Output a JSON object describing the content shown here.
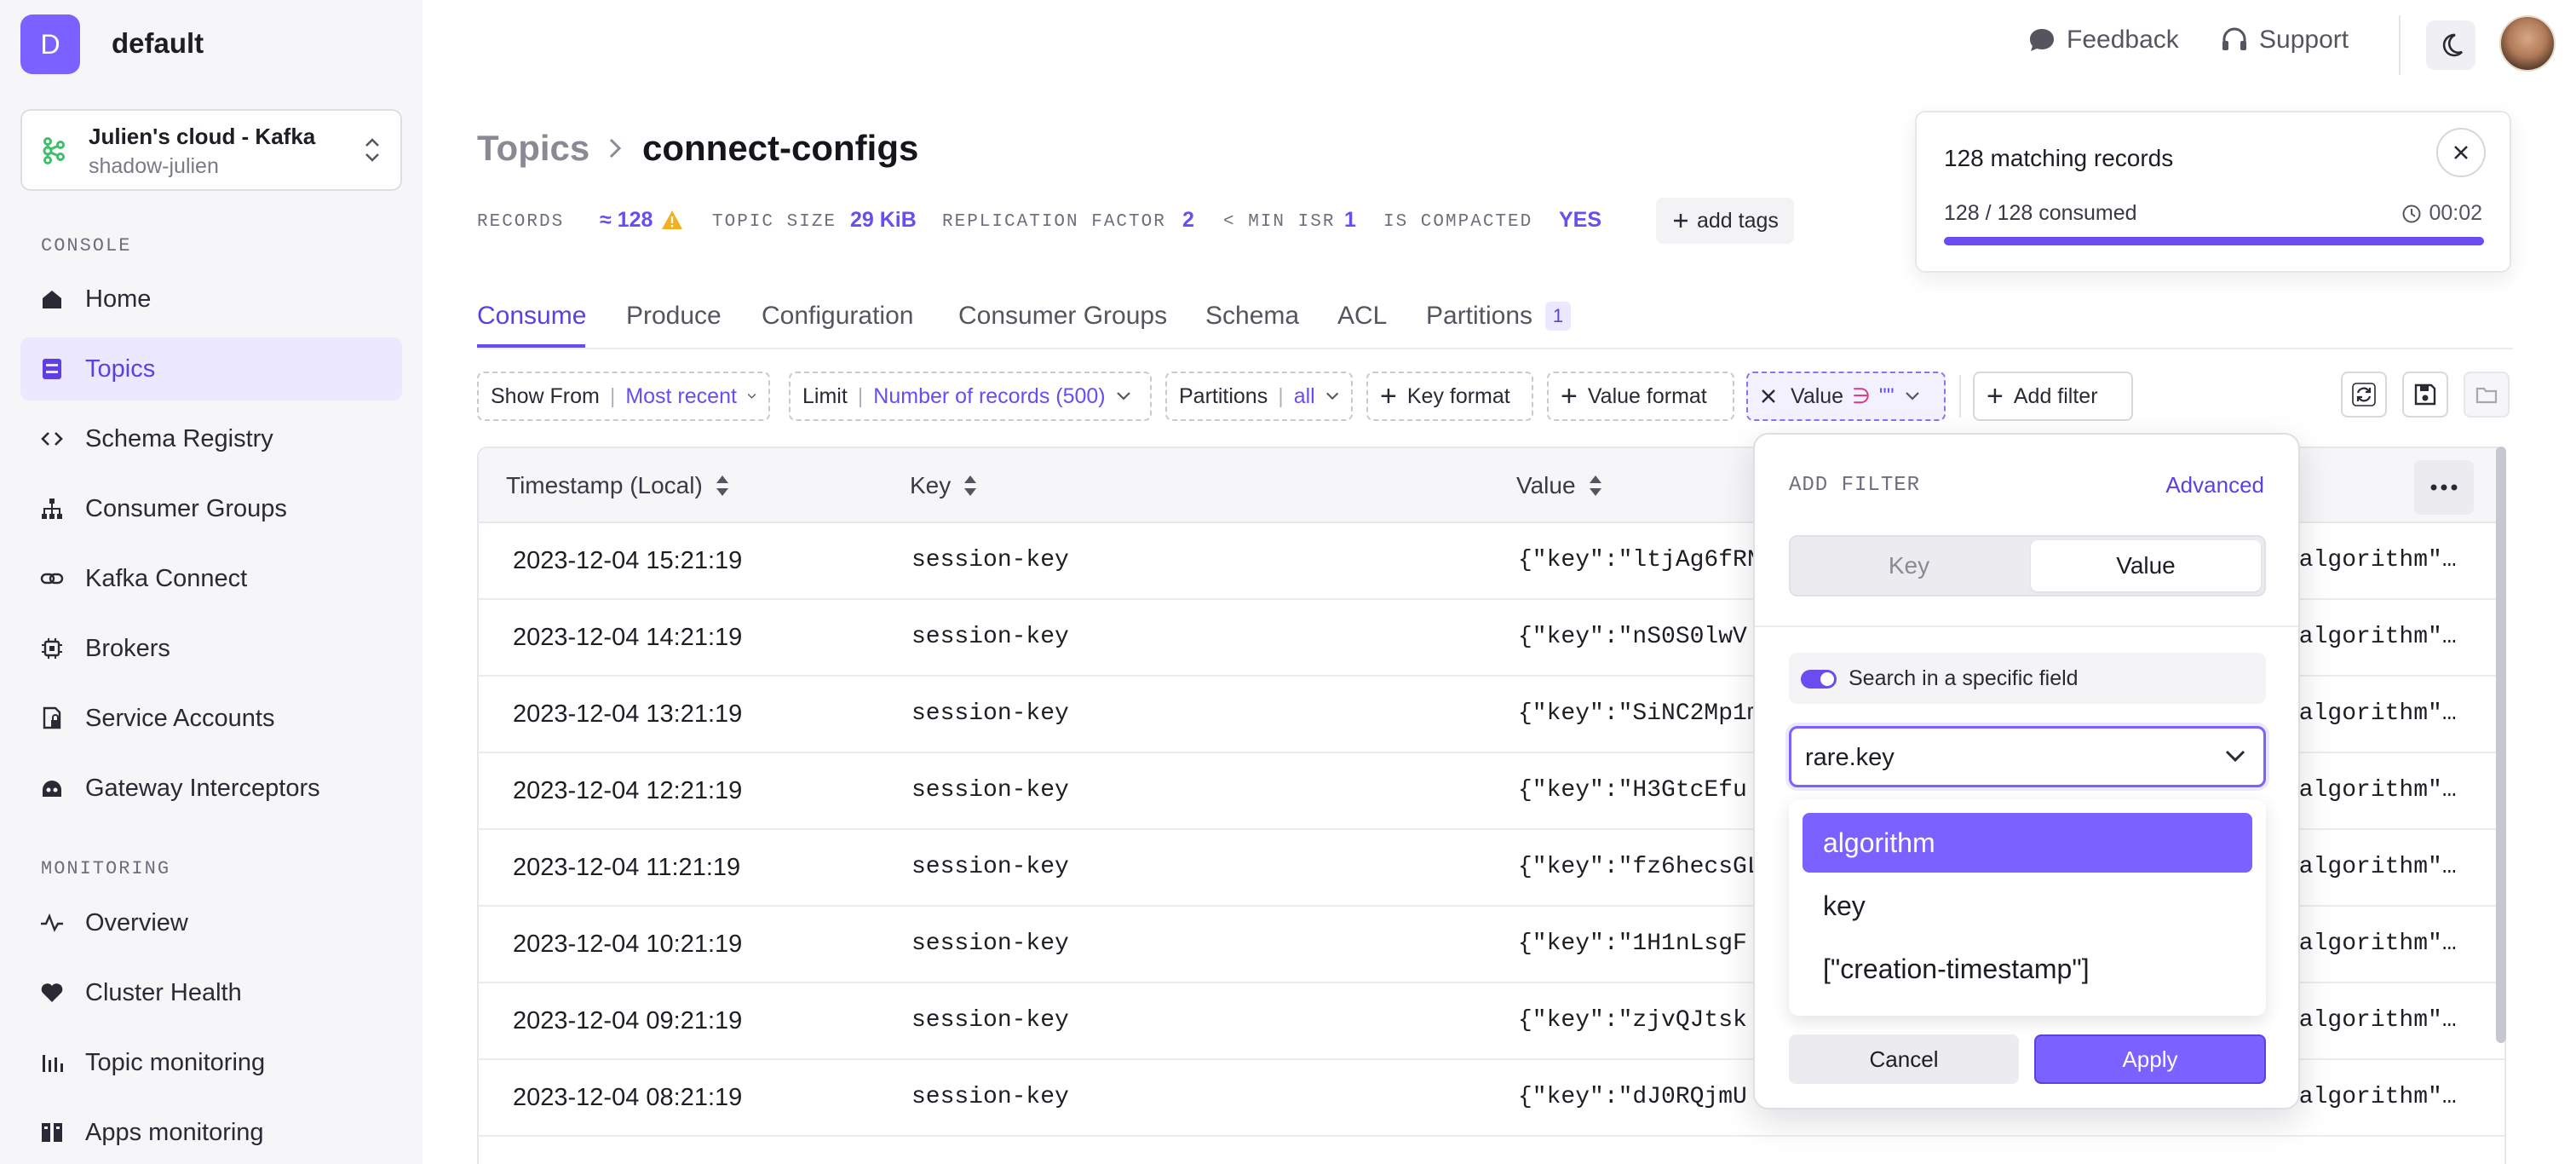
{
  "org": {
    "initial": "D",
    "name": "default"
  },
  "cluster": {
    "name": "Julien's cloud - Kafka",
    "sub": "shadow-julien"
  },
  "sidebar": {
    "console_label": "CONSOLE",
    "console_items": [
      {
        "label": "Home",
        "icon": "home-icon"
      },
      {
        "label": "Topics",
        "icon": "topics-icon",
        "active": true
      },
      {
        "label": "Schema Registry",
        "icon": "code-icon"
      },
      {
        "label": "Consumer Groups",
        "icon": "hierarchy-icon"
      },
      {
        "label": "Kafka Connect",
        "icon": "link-icon"
      },
      {
        "label": "Brokers",
        "icon": "chip-icon"
      },
      {
        "label": "Service Accounts",
        "icon": "lock-doc-icon"
      },
      {
        "label": "Gateway Interceptors",
        "icon": "gateway-icon"
      }
    ],
    "monitoring_label": "MONITORING",
    "monitoring_items": [
      {
        "label": "Overview",
        "icon": "pulse-icon"
      },
      {
        "label": "Cluster Health",
        "icon": "heart-icon"
      },
      {
        "label": "Topic monitoring",
        "icon": "bar-chart-icon"
      },
      {
        "label": "Apps monitoring",
        "icon": "apps-icon"
      }
    ]
  },
  "topbar": {
    "feedback": "Feedback",
    "support": "Support"
  },
  "breadcrumb": {
    "parent": "Topics",
    "current": "connect-configs"
  },
  "meta": {
    "records_label": "RECORDS",
    "records_value": "≈ 128",
    "size_label": "TOPIC SIZE",
    "size_value": "29 KiB",
    "replication_label": "REPLICATION FACTOR",
    "replication_value": "2",
    "isr_label": "< MIN ISR",
    "isr_value": "1",
    "compacted_label": "IS COMPACTED",
    "compacted_value": "YES",
    "add_tags": "add tags"
  },
  "tabs": {
    "consume": "Consume",
    "produce": "Produce",
    "configuration": "Configuration",
    "consumer_groups": "Consumer Groups",
    "schema": "Schema",
    "acl": "ACL",
    "partitions": "Partitions",
    "partitions_count": "1"
  },
  "filters": {
    "show_from_label": "Show From",
    "show_from_value": "Most recent",
    "limit_label": "Limit",
    "limit_value": "Number of records (500)",
    "partitions_label": "Partitions",
    "partitions_value": "all",
    "key_format": "Key format",
    "value_format": "Value format",
    "value_filter_label": "Value",
    "value_filter_op": "∋",
    "value_filter_val": "\"\"",
    "add_filter": "Add filter"
  },
  "table": {
    "headers": {
      "timestamp": "Timestamp (Local)",
      "key": "Key",
      "value": "Value"
    },
    "rows": [
      {
        "ts": "2023-12-04 15:21:19",
        "key": "session-key",
        "value": "{\"key\":\"ltjAg6fRN",
        "tail": "\"algorithm\"…"
      },
      {
        "ts": "2023-12-04 14:21:19",
        "key": "session-key",
        "value": "{\"key\":\"nS0S0lwV",
        "tail": "\"algorithm\"…"
      },
      {
        "ts": "2023-12-04 13:21:19",
        "key": "session-key",
        "value": "{\"key\":\"SiNC2Mp1m",
        "tail": "\"algorithm\"…"
      },
      {
        "ts": "2023-12-04 12:21:19",
        "key": "session-key",
        "value": "{\"key\":\"H3GtcEfu",
        "tail": "\"algorithm\"…"
      },
      {
        "ts": "2023-12-04 11:21:19",
        "key": "session-key",
        "value": "{\"key\":\"fz6hecsGL",
        "tail": "\"algorithm\"…"
      },
      {
        "ts": "2023-12-04 10:21:19",
        "key": "session-key",
        "value": "{\"key\":\"1H1nLsgF",
        "tail": "\"algorithm\"…"
      },
      {
        "ts": "2023-12-04 09:21:19",
        "key": "session-key",
        "value": "{\"key\":\"zjvQJtsk",
        "tail": "\"algorithm\"…"
      },
      {
        "ts": "2023-12-04 08:21:19",
        "key": "session-key",
        "value": "{\"key\":\"dJ0RQjmU",
        "tail": "\"algorithm\"…"
      }
    ]
  },
  "toast": {
    "title": "128 matching records",
    "consumed": "128 / 128 consumed",
    "time": "00:02",
    "progress": 1.0
  },
  "popover": {
    "title": "ADD FILTER",
    "advanced": "Advanced",
    "seg_key": "Key",
    "seg_value": "Value",
    "toggle_label": "Search in a specific field",
    "field_value": "rare.key",
    "options": [
      "algorithm",
      "key",
      "[\"creation-timestamp\"]"
    ],
    "cancel": "Cancel",
    "apply": "Apply"
  },
  "colors": {
    "accent": "#6a4cf0",
    "accent_light": "#ebe8ff"
  }
}
